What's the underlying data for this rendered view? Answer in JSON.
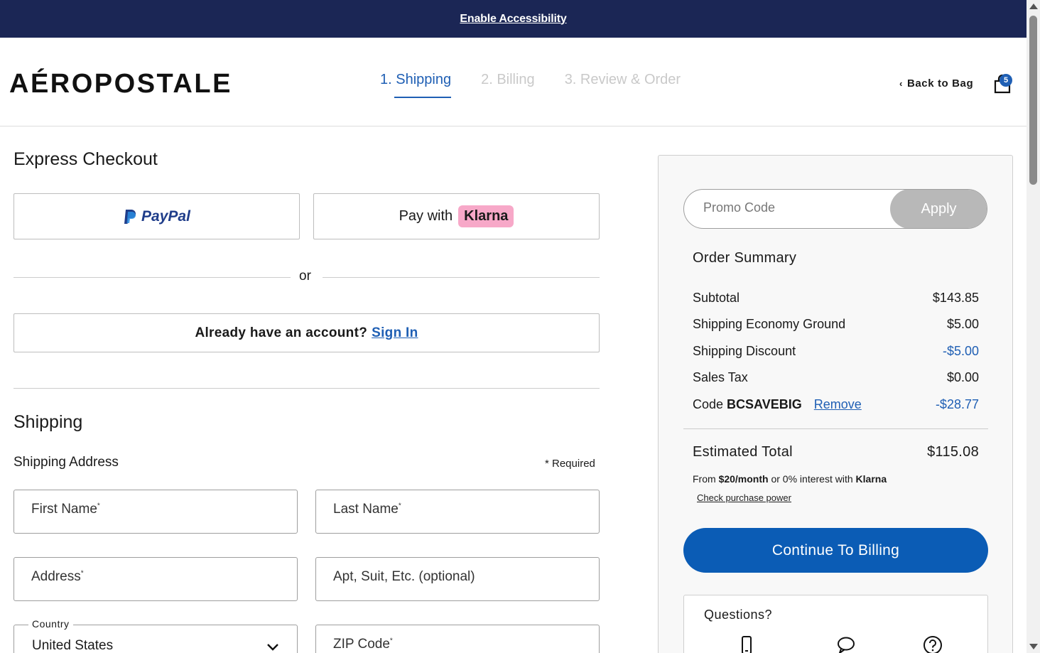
{
  "banner": {
    "link": "Enable Accessibility"
  },
  "header": {
    "logo": "AÉROPOSTALE",
    "steps": [
      "1. Shipping",
      "2. Billing",
      "3. Review & Order"
    ],
    "back_to_bag": "Back to Bag",
    "bag_count": "5"
  },
  "express": {
    "title": "Express Checkout",
    "paypal": "PayPal",
    "klarna_prefix": "Pay with",
    "klarna_brand": "Klarna",
    "or": "or",
    "account_question": "Already have an account?",
    "sign_in": "Sign In"
  },
  "shipping": {
    "title": "Shipping",
    "address_label": "Shipping Address",
    "required_note": "* Required",
    "fields": {
      "first_name": "First Name",
      "last_name": "Last Name",
      "address": "Address",
      "apt": "Apt, Suit, Etc. (optional)",
      "country_label": "Country",
      "country_value": "United States",
      "zip": "ZIP Code"
    },
    "required_mark": "*"
  },
  "summary": {
    "promo_placeholder": "Promo Code",
    "apply": "Apply",
    "title": "Order Summary",
    "rows": [
      {
        "label": "Subtotal",
        "value": "$143.85"
      },
      {
        "label": "Shipping Economy Ground",
        "value": "$5.00"
      },
      {
        "label": "Shipping Discount",
        "value": "-$5.00"
      },
      {
        "label": "Sales Tax",
        "value": "$0.00"
      }
    ],
    "code": {
      "prefix": "Code",
      "code": "BCSAVEBIG",
      "remove": "Remove",
      "value": "-$28.77"
    },
    "total_label": "Estimated Total",
    "total_value": "$115.08",
    "klarna_note": {
      "from": "From",
      "amount": "$20/month",
      "middle": "or 0% interest with",
      "brand": "Klarna"
    },
    "check_power": "Check purchase power",
    "continue": "Continue To Billing",
    "questions": "Questions?"
  }
}
